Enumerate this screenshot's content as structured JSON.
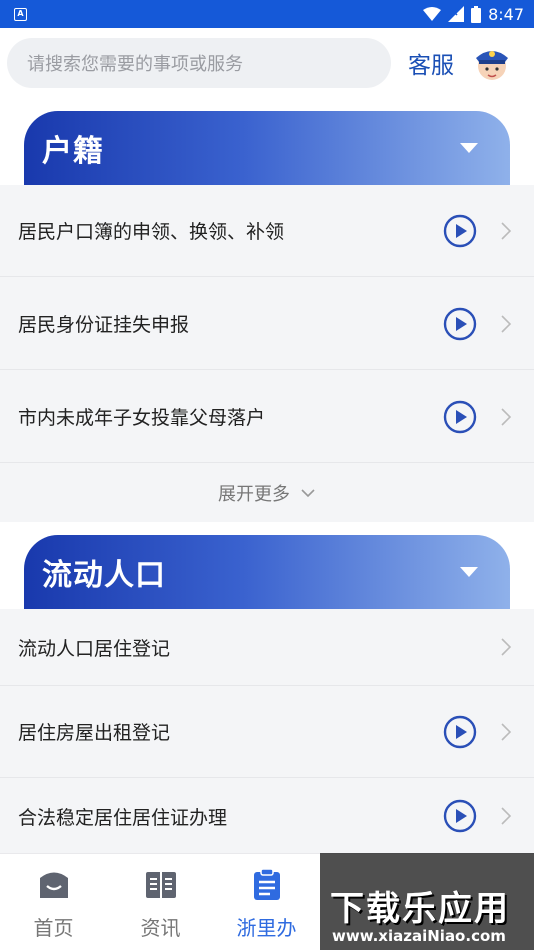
{
  "status_bar": {
    "time": "8:47",
    "app_icon": "A"
  },
  "header": {
    "search_placeholder": "请搜索您需要的事项或服务",
    "service_label": "客服"
  },
  "sections": [
    {
      "title": "户籍",
      "items": [
        {
          "label": "居民户口簿的申领、换领、补领",
          "has_video": true
        },
        {
          "label": "居民身份证挂失申报",
          "has_video": true
        },
        {
          "label": "市内未成年子女投靠父母落户",
          "has_video": true
        }
      ],
      "expand_label": "展开更多"
    },
    {
      "title": "流动人口",
      "items": [
        {
          "label": "流动人口居住登记",
          "has_video": false
        },
        {
          "label": "居住房屋出租登记",
          "has_video": true
        },
        {
          "label": "合法稳定居住居住证办理",
          "has_video": true
        }
      ]
    }
  ],
  "bottom_nav": [
    {
      "label": "首页",
      "icon": "home-icon",
      "active": false
    },
    {
      "label": "资讯",
      "icon": "news-icon",
      "active": false
    },
    {
      "label": "浙里办",
      "icon": "clipboard-icon",
      "active": true
    }
  ],
  "watermark": {
    "main": "下载乐应用",
    "url": "www.xiazaiNiao.com"
  },
  "colors": {
    "primary": "#1559d8",
    "accent": "#2f6be0",
    "section_gradient_start": "#1939ad",
    "section_gradient_end": "#8fb1ea"
  }
}
